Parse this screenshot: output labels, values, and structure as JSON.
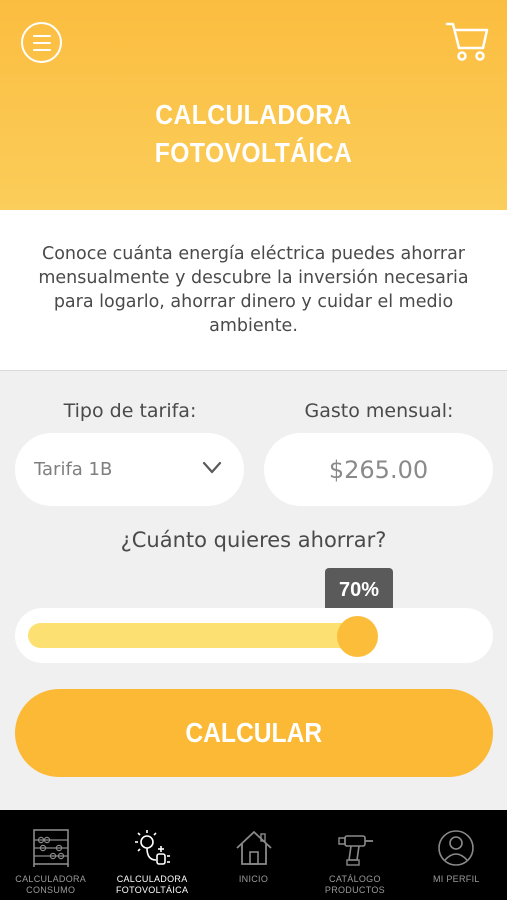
{
  "header": {
    "title_line1": "CALCULADORA",
    "title_line2": "FOTOVOLTÁICA",
    "menu_icon": "hamburger-menu-icon",
    "cart_icon": "shopping-cart-icon"
  },
  "intro": {
    "text": "Conoce cuánta energía eléctrica puedes ahorrar mensualmente y descubre la inversión necesaria para logarlo, ahorrar dinero y cuidar el medio ambiente."
  },
  "form": {
    "tarifa_label": "Tipo de tarifa:",
    "tarifa_value": "Tarifa 1B",
    "gasto_label": "Gasto mensual:",
    "gasto_value": "$265.00",
    "question": "¿Cuánto quieres ahorrar?",
    "savings_percent_label": "70%",
    "savings_fraction": 0.7,
    "calc_button": "CALCULAR"
  },
  "tabbar": {
    "items": [
      {
        "line1": "CALCULADORA",
        "line2": "CONSUMO",
        "icon": "abacus-icon",
        "active": false
      },
      {
        "line1": "CALCULADORA",
        "line2": "FOTOVOLTÁICA",
        "icon": "sun-plug-icon",
        "active": true
      },
      {
        "line1": "INICIO",
        "line2": "",
        "icon": "home-icon",
        "active": false
      },
      {
        "line1": "CATÁLOGO",
        "line2": "PRODUCTOS",
        "icon": "drill-icon",
        "active": false
      },
      {
        "line1": "MI PERFIL",
        "line2": "",
        "icon": "profile-icon",
        "active": false
      }
    ]
  },
  "colors": {
    "brand_orange": "#fbbd3f",
    "slider_fill": "#fde072",
    "tooltip_bg": "#5a5a5a",
    "tabbar_bg": "#000000"
  }
}
